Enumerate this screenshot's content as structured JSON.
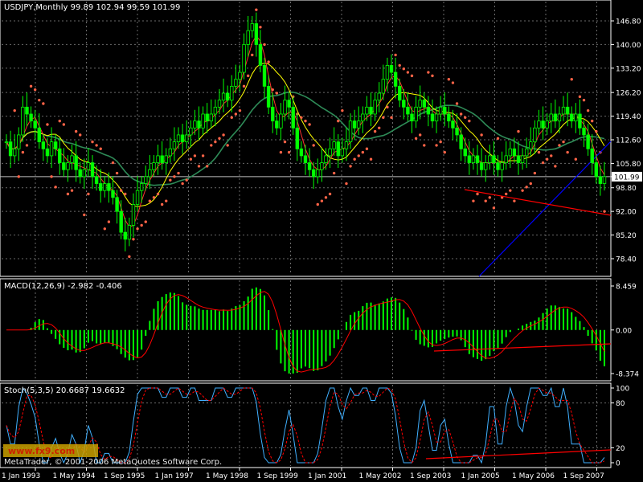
{
  "chart_data": [
    {
      "type": "candlestick",
      "title": "USDJPY,Monthly  99.89 102.94 99.59 101.99",
      "symbol": "USDJPY",
      "timeframe": "Monthly",
      "ohlc_last": {
        "open": 99.89,
        "high": 102.94,
        "low": 99.59,
        "close": 101.99
      },
      "current_price_label": "101.99",
      "y_ticks": [
        "146.80",
        "140.00",
        "133.20",
        "126.20",
        "119.40",
        "112.60",
        "105.80",
        "101.99",
        "98.80",
        "92.00",
        "85.20",
        "78.40"
      ],
      "ylim": [
        78.4,
        146.8
      ],
      "x_ticks": [
        "1 Jan 1993",
        "1 May 1994",
        "1 Sep 1995",
        "1 Jan 1997",
        "1 May 1998",
        "1 Sep 1999",
        "1 Jan 2001",
        "1 May 2002",
        "1 Sep 2003",
        "1 Jan 2005",
        "1 May 2006",
        "1 Sep 2007"
      ],
      "colors": {
        "up": "#00ff00",
        "down": "#00ff00",
        "ma_slow": "#2e8b57",
        "ma_fast": "#ffff00",
        "ma_red": "#ff3030",
        "sar": "#ff6347",
        "trend_blue": "#0000ff",
        "trend_red": "#ff0000"
      },
      "close_series": [
        112,
        108,
        110,
        114,
        122,
        120,
        118,
        116,
        112,
        110,
        108,
        112,
        110,
        106,
        104,
        106,
        108,
        104,
        102,
        104,
        106,
        102,
        100,
        98,
        100,
        98,
        96,
        92,
        86,
        84,
        88,
        94,
        98,
        100,
        102,
        104,
        106,
        108,
        106,
        108,
        110,
        112,
        114,
        112,
        114,
        116,
        118,
        116,
        120,
        118,
        120,
        122,
        124,
        126,
        124,
        128,
        130,
        132,
        140,
        144,
        146,
        140,
        134,
        128,
        122,
        118,
        116,
        120,
        124,
        122,
        116,
        110,
        108,
        106,
        104,
        102,
        104,
        106,
        108,
        110,
        112,
        108,
        110,
        112,
        118,
        116,
        118,
        120,
        122,
        120,
        124,
        126,
        130,
        134,
        132,
        128,
        124,
        122,
        120,
        118,
        122,
        124,
        122,
        120,
        118,
        120,
        122,
        120,
        118,
        116,
        114,
        110,
        108,
        106,
        108,
        106,
        104,
        106,
        108,
        106,
        104,
        106,
        108,
        110,
        108,
        106,
        108,
        110,
        112,
        116,
        118,
        116,
        118,
        120,
        118,
        120,
        122,
        120,
        118,
        120,
        116,
        114,
        110,
        106,
        102,
        100,
        102
      ]
    },
    {
      "type": "macd",
      "title": "MACD(12,26,9) -2.982 -0.406",
      "params": "12,26,9",
      "values_label": {
        "macd": -2.982,
        "signal": -0.406
      },
      "y_ticks": [
        "8.459",
        "0.00",
        "-8.374"
      ],
      "ylim": [
        -8.374,
        8.459
      ],
      "colors": {
        "histogram": "#00ff00",
        "signal": "#ff0000",
        "trend": "#ff0000"
      }
    },
    {
      "type": "stochastic",
      "title": "Stoch(5,3,5) 20.6687 19.6632",
      "params": "5,3,5",
      "values_label": {
        "main": 20.6687,
        "signal": 19.6632
      },
      "y_ticks": [
        "100",
        "80",
        "20",
        "0"
      ],
      "ylim": [
        0,
        100
      ],
      "colors": {
        "main": "#40b0ff",
        "signal": "#ff0000",
        "trend": "#ff0000"
      }
    }
  ],
  "footer": {
    "copyright": "MetaTrader, © 2001-2006 MetaQuotes Software Corp.",
    "watermark_text": "www.fx9.com"
  }
}
